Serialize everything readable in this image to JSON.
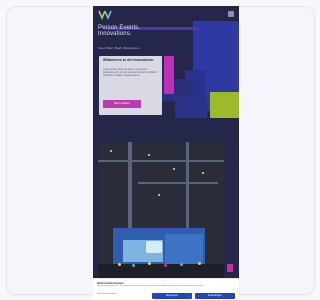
{
  "hero": {
    "title": "Person Events. Innovations.",
    "subtitle": "Kaos. Bash. Bash. Bashaguten."
  },
  "intro": {
    "heading": "Willkommen zu den Innovationen",
    "text": "Lorem ipsum dolor sit amet, consectetur adipiscing elit, sed do eiusmod tempor incididunt ut labore et dolore magna aliqua.",
    "button_label": "Mehr erfahren"
  },
  "cookie": {
    "title": "Datenschutzhinweis",
    "text": "Wir verwenden Cookies, um Inhalte und Anzeigen zu personalisieren und die Zugriffe auf unsere Website zu analysieren.",
    "link_label": "Datenschutzerklärung",
    "accept_label": "Akzeptieren",
    "settings_label": "Einstellungen"
  },
  "colors": {
    "background": "#24264a",
    "accent_magenta": "#c22fb6",
    "accent_lime": "#9bbb2a",
    "accent_blue": "#2f39a3",
    "button_blue": "#2546b8"
  },
  "icons": {
    "logo": "brand-logo-icon",
    "menu": "menu-icon"
  }
}
